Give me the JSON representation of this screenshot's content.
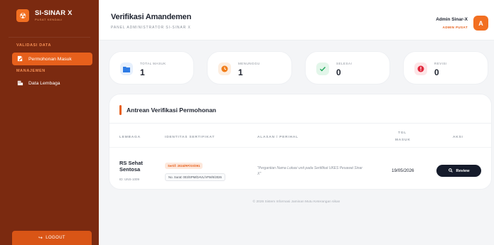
{
  "brand": {
    "title": "SI-SINAR X",
    "subtitle": "PUSAT KENDALI",
    "logo_icon": "radiation-icon"
  },
  "sidebar": {
    "sections": [
      {
        "label": "VALIDASI DATA"
      },
      {
        "label": "MANAJEMEN"
      }
    ],
    "items": [
      {
        "label": "Permohonan Masuk",
        "icon": "file-edit-icon",
        "active": true
      },
      {
        "label": "Data Lembaga",
        "icon": "building-icon",
        "active": false
      }
    ],
    "logout_label": "LOGOUT"
  },
  "header": {
    "title": "Verifikasi Amandemen",
    "subtitle": "PANEL ADMINISTRATOR SI-SINAR X",
    "user_name": "Admin Sinar-X",
    "user_role": "ADMIN PUSAT",
    "avatar_initial": "A"
  },
  "stats": [
    {
      "label": "TOTAL MASUK",
      "value": "1",
      "icon": "folder-icon",
      "color": "#2d7be5",
      "bg": "#e6f0fd"
    },
    {
      "label": "MENUNGGU",
      "value": "1",
      "icon": "clock-icon",
      "color": "#f07d1a",
      "bg": "#fdeee0"
    },
    {
      "label": "SELESAI",
      "value": "0",
      "icon": "check-icon",
      "color": "#1fa75a",
      "bg": "#e3f6ea"
    },
    {
      "label": "REVISI",
      "value": "0",
      "icon": "alert-icon",
      "color": "#e0283c",
      "bg": "#fde5e7"
    }
  ],
  "queue": {
    "title": "Antrean Verifikasi Permohonan",
    "columns": [
      "LEMBAGA",
      "IDENTITAS SERTIFIKAT",
      "ALASAN / PERIHAL",
      "TGL",
      "MASUK",
      "AKSI"
    ],
    "rows": [
      {
        "name_line1": "RS Sehat",
        "name_line2": "Sentosa",
        "id": "ID: UNS-1009",
        "cert": "Sertif: 2024/RF/XX/091",
        "surat": "No. Surat: 003/SPM/DAVL/VFM/II/2026",
        "reason": "\"Pergantian Nama Lokasi unit pada Sertifikat UKES Pesawat Sinar X\"",
        "date": "19/05/2026",
        "action": "Review"
      }
    ]
  },
  "footer": "© 2026 Sistem Informasi Jaminan Mutu Keterangan sikan",
  "colors": {
    "sidebar": "#7b2a10",
    "accent": "#e7601c",
    "dark_button": "#151b2b"
  }
}
